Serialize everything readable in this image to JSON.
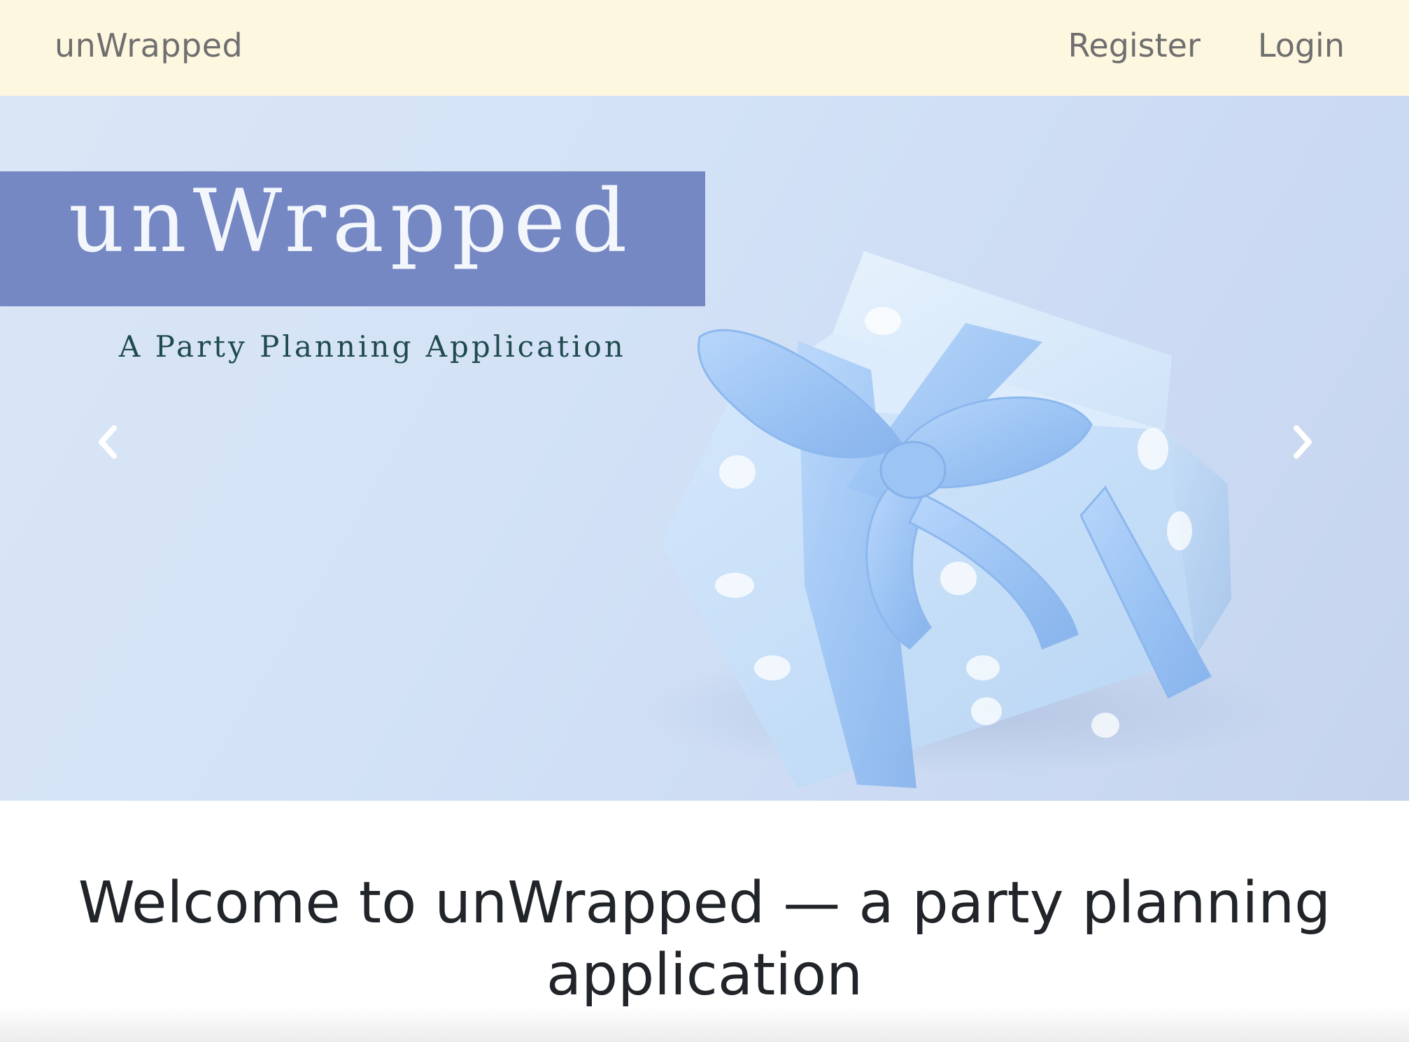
{
  "navbar": {
    "brand": "unWrapped",
    "links": [
      {
        "label": "Register"
      },
      {
        "label": "Login"
      }
    ]
  },
  "hero": {
    "title": "unWrapped",
    "subtitle": "A Party Planning Application",
    "icons": {
      "prev": "chevron-left-icon",
      "next": "chevron-right-icon"
    },
    "colors": {
      "title_box": "#7588c4",
      "subtitle_text": "#1f4a4e"
    }
  },
  "welcome": {
    "line1": "Welcome to unWrapped — a party planning",
    "line2": "application"
  },
  "colors": {
    "navbar_bg": "#fdf7df",
    "nav_text": "#6f6f6f",
    "heading_text": "#212529"
  }
}
